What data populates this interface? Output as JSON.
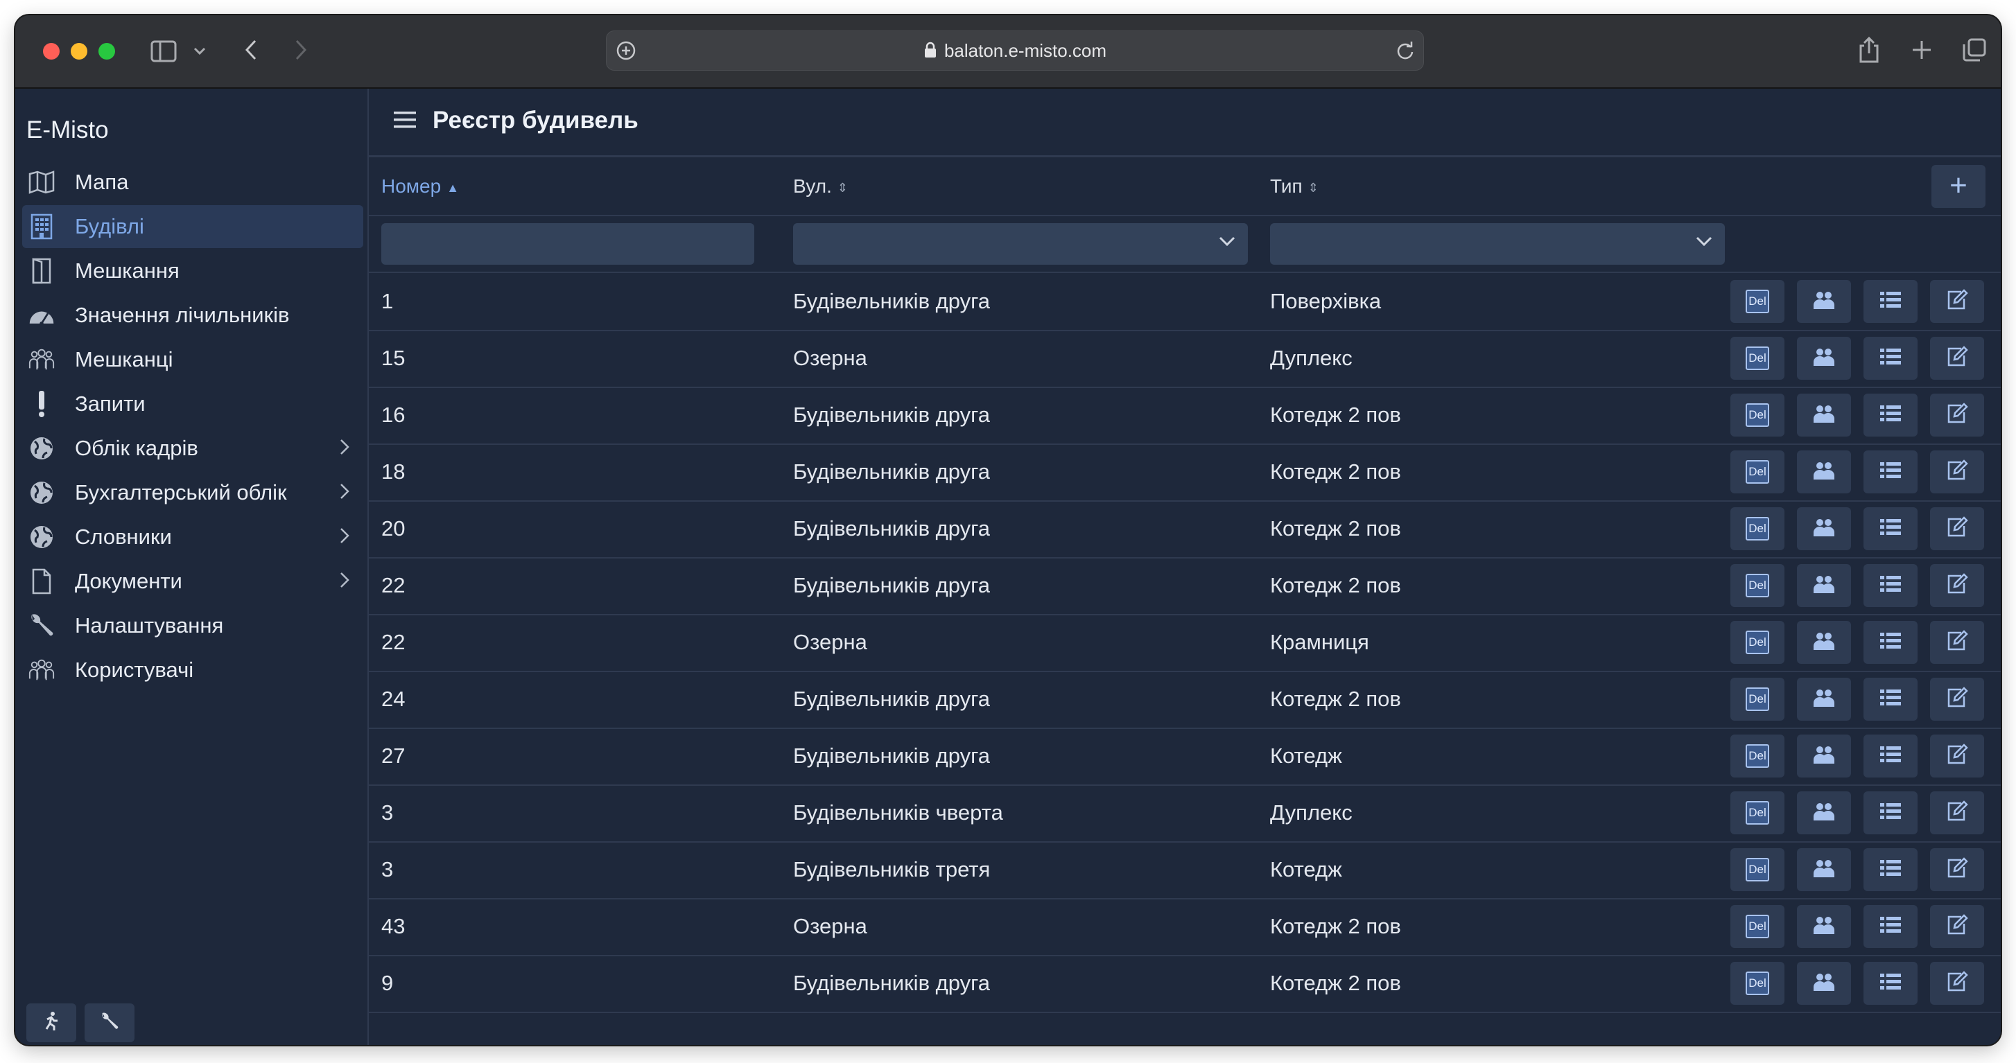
{
  "browser": {
    "url": "balaton.e-misto.com"
  },
  "app": {
    "brand": "E-Misto",
    "page_title": "Реєстр будивель"
  },
  "sidebar": {
    "items": [
      {
        "label": "Мапа",
        "icon": "map-icon",
        "active": false,
        "submenu": false
      },
      {
        "label": "Будівлі",
        "icon": "building-icon",
        "active": true,
        "submenu": false
      },
      {
        "label": "Мешкання",
        "icon": "door-icon",
        "active": false,
        "submenu": false
      },
      {
        "label": "Значення лічильників",
        "icon": "gauge-icon",
        "active": false,
        "submenu": false
      },
      {
        "label": "Мешканці",
        "icon": "people-icon",
        "active": false,
        "submenu": false
      },
      {
        "label": "Запити",
        "icon": "exclamation-icon",
        "active": false,
        "submenu": false
      },
      {
        "label": "Облік кадрів",
        "icon": "globe-icon",
        "active": false,
        "submenu": true
      },
      {
        "label": "Бухгалтерський облік",
        "icon": "globe-icon",
        "active": false,
        "submenu": true
      },
      {
        "label": "Словники",
        "icon": "globe-icon",
        "active": false,
        "submenu": true
      },
      {
        "label": "Документи",
        "icon": "file-icon",
        "active": false,
        "submenu": true
      },
      {
        "label": "Налаштування",
        "icon": "wrench-icon",
        "active": false,
        "submenu": false
      },
      {
        "label": "Користувачі",
        "icon": "people-icon",
        "active": false,
        "submenu": false
      }
    ]
  },
  "table": {
    "columns": [
      {
        "label": "Номер",
        "sort": "asc"
      },
      {
        "label": "Вул.",
        "sort": "none"
      },
      {
        "label": "Тип",
        "sort": "none"
      }
    ],
    "add_label": "+",
    "del_label": "Del",
    "rows": [
      {
        "number": "1",
        "street": "Будівельників друга",
        "type": "Поверхівка"
      },
      {
        "number": "15",
        "street": "Озерна",
        "type": "Дуплекс"
      },
      {
        "number": "16",
        "street": "Будівельників друга",
        "type": "Котедж 2 пов"
      },
      {
        "number": "18",
        "street": "Будівельників друга",
        "type": "Котедж 2 пов"
      },
      {
        "number": "20",
        "street": "Будівельників друга",
        "type": "Котедж 2 пов"
      },
      {
        "number": "22",
        "street": "Будівельників друга",
        "type": "Котедж 2 пов"
      },
      {
        "number": "22",
        "street": "Озерна",
        "type": "Крамниця"
      },
      {
        "number": "24",
        "street": "Будівельників друга",
        "type": "Котедж 2 пов"
      },
      {
        "number": "27",
        "street": "Будівельників друга",
        "type": "Котедж"
      },
      {
        "number": "3",
        "street": "Будівельників чверта",
        "type": "Дуплекс"
      },
      {
        "number": "3",
        "street": "Будівельників третя",
        "type": "Котедж"
      },
      {
        "number": "43",
        "street": "Озерна",
        "type": "Котедж 2 пов"
      },
      {
        "number": "9",
        "street": "Будівельників друга",
        "type": "Котедж 2 пов"
      }
    ]
  },
  "colors": {
    "background": "#1e283b",
    "accent": "#7ea7e6",
    "button": "#2e3b52"
  }
}
